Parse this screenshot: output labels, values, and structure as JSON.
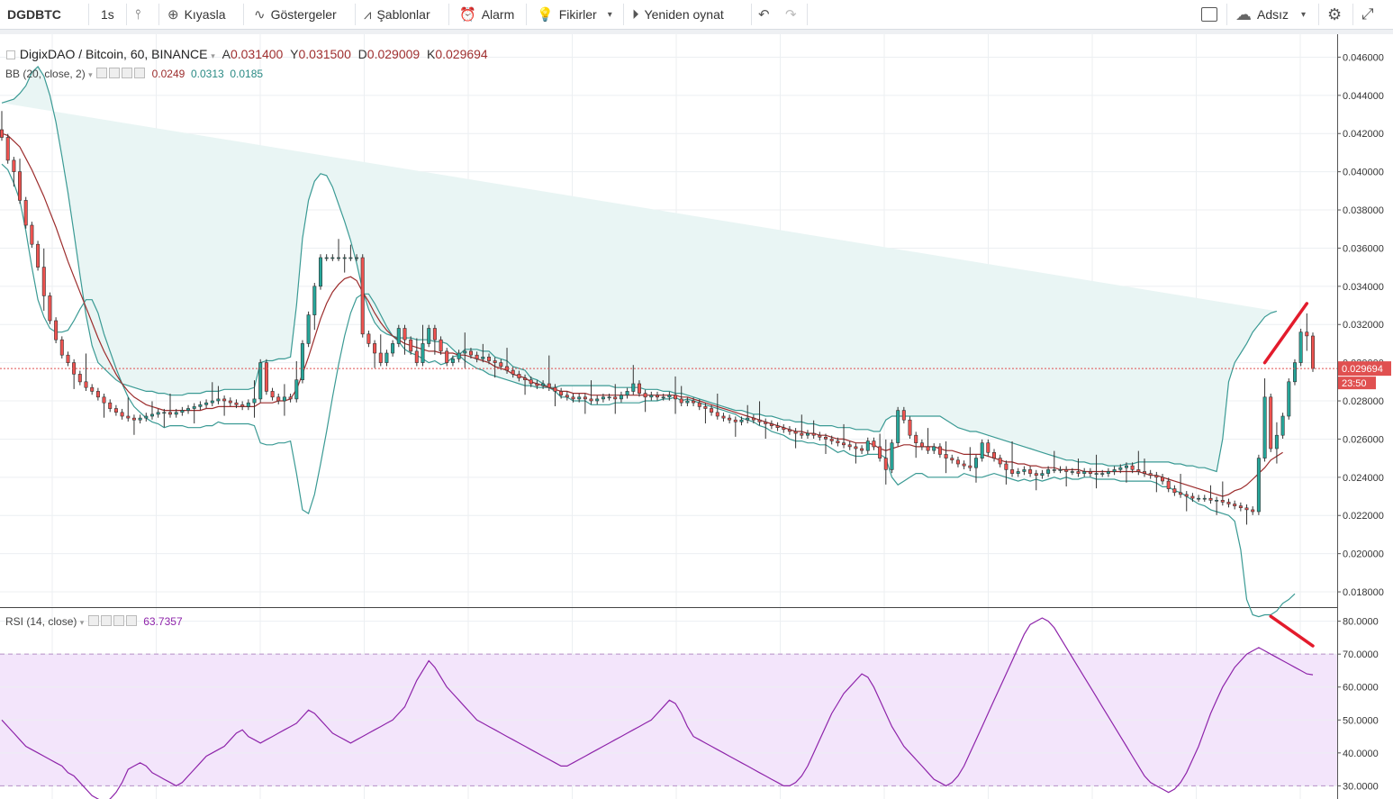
{
  "toolbar": {
    "symbol": "DGDBTC",
    "interval": "1s",
    "compare": "Kıyasla",
    "indicators": "Göstergeler",
    "templates": "Şablonlar",
    "alarm": "Alarm",
    "ideas": "Fikirler",
    "replay": "Yeniden oynat",
    "layout_name": "Adsız"
  },
  "legend": {
    "title": "DigixDAO / Bitcoin, 60, BINANCE",
    "o_label": "A",
    "o_value": "0.031400",
    "h_label": "Y",
    "h_value": "0.031500",
    "l_label": "D",
    "l_value": "0.029009",
    "c_label": "K",
    "c_value": "0.029694",
    "bb_label": "BB (20, close, 2)",
    "bb_mid": "0.0249",
    "bb_upper": "0.0313",
    "bb_lower": "0.0185",
    "rsi_label": "RSI (14, close)",
    "rsi_value": "63.7357"
  },
  "colors": {
    "up": "#26a69a",
    "down": "#ef5350",
    "candle_border": "#333333",
    "bb_band": "#3a9a94",
    "bb_fill": "#e9f5f4",
    "bb_basis": "#9c2c2c",
    "rsi_line": "#8e24aa",
    "rsi_band": "#f3e5fb",
    "annot": "#e31b2c",
    "last_price_bg": "#e05050"
  },
  "chart_data": [
    {
      "type": "candlestick",
      "title": "DigixDAO / Bitcoin, 60, BINANCE",
      "ylim": [
        0.0172,
        0.0472
      ],
      "yticks": [
        "0.046000",
        "0.044000",
        "0.042000",
        "0.040000",
        "0.038000",
        "0.036000",
        "0.034000",
        "0.032000",
        "0.030000",
        "0.028000",
        "0.026000",
        "0.024000",
        "0.022000",
        "0.020000",
        "0.018000"
      ],
      "last_price": "0.029694",
      "countdown": "23:50",
      "close": [
        0.0418,
        0.0406,
        0.04,
        0.0385,
        0.0372,
        0.0362,
        0.035,
        0.0335,
        0.0322,
        0.0312,
        0.0304,
        0.03,
        0.0294,
        0.029,
        0.0287,
        0.0285,
        0.0282,
        0.0279,
        0.0276,
        0.0274,
        0.0272,
        0.0271,
        0.027,
        0.0271,
        0.0272,
        0.0273,
        0.0274,
        0.0274,
        0.0273,
        0.0274,
        0.0275,
        0.0276,
        0.0277,
        0.0278,
        0.0279,
        0.028,
        0.0281,
        0.028,
        0.0279,
        0.0278,
        0.0277,
        0.0279,
        0.0281,
        0.03,
        0.0285,
        0.0282,
        0.028,
        0.0282,
        0.0281,
        0.0291,
        0.031,
        0.0325,
        0.034,
        0.0355,
        0.0355,
        0.0355,
        0.0355,
        0.0355,
        0.0355,
        0.0355,
        0.0315,
        0.031,
        0.0305,
        0.03,
        0.0305,
        0.031,
        0.0318,
        0.0312,
        0.0306,
        0.03,
        0.031,
        0.0318,
        0.0312,
        0.0306,
        0.03,
        0.0302,
        0.0305,
        0.0306,
        0.0304,
        0.0302,
        0.0303,
        0.0301,
        0.03,
        0.0298,
        0.0296,
        0.0294,
        0.0292,
        0.0291,
        0.0289,
        0.0288,
        0.0289,
        0.0287,
        0.0285,
        0.0283,
        0.0282,
        0.0281,
        0.0282,
        0.0281,
        0.028,
        0.0281,
        0.0282,
        0.0282,
        0.0281,
        0.0283,
        0.0285,
        0.0289,
        0.0284,
        0.0282,
        0.0283,
        0.0282,
        0.0282,
        0.0283,
        0.0281,
        0.0279,
        0.028,
        0.0279,
        0.0277,
        0.0276,
        0.0274,
        0.0272,
        0.0271,
        0.027,
        0.0269,
        0.027,
        0.0271,
        0.027,
        0.0269,
        0.0268,
        0.0267,
        0.0266,
        0.0265,
        0.0264,
        0.0263,
        0.0262,
        0.0263,
        0.0262,
        0.0261,
        0.026,
        0.0259,
        0.0258,
        0.0257,
        0.0256,
        0.0255,
        0.0254,
        0.0259,
        0.0256,
        0.025,
        0.0244,
        0.0258,
        0.0275,
        0.027,
        0.0262,
        0.0258,
        0.0256,
        0.0254,
        0.0256,
        0.0252,
        0.025,
        0.0249,
        0.0247,
        0.0246,
        0.0245,
        0.025,
        0.0258,
        0.0253,
        0.025,
        0.0247,
        0.0244,
        0.0242,
        0.0243,
        0.0244,
        0.0242,
        0.0241,
        0.0242,
        0.0244,
        0.0244,
        0.0244,
        0.0243,
        0.0243,
        0.0242,
        0.0243,
        0.0242,
        0.0242,
        0.0242,
        0.0243,
        0.0244,
        0.0245,
        0.0246,
        0.0244,
        0.0243,
        0.0242,
        0.0241,
        0.024,
        0.0238,
        0.0234,
        0.0232,
        0.0231,
        0.023,
        0.0229,
        0.0229,
        0.0229,
        0.0228,
        0.0228,
        0.0227,
        0.0226,
        0.0225,
        0.0224,
        0.0223,
        0.0222,
        0.025,
        0.0282,
        0.0255,
        0.0262,
        0.0272,
        0.029,
        0.03,
        0.0316,
        0.0314,
        0.0297
      ],
      "bb_basis": [
        0.042,
        0.0419,
        0.0416,
        0.0413,
        0.0407,
        0.0401,
        0.0394,
        0.0387,
        0.0379,
        0.0371,
        0.0362,
        0.0353,
        0.0345,
        0.0337,
        0.0329,
        0.0321,
        0.0313,
        0.0306,
        0.03,
        0.0294,
        0.0289,
        0.0285,
        0.0282,
        0.028,
        0.0278,
        0.0277,
        0.0276,
        0.0275,
        0.0275,
        0.0275,
        0.0275,
        0.0275,
        0.0275,
        0.0275,
        0.0276,
        0.0276,
        0.0277,
        0.0277,
        0.0277,
        0.0277,
        0.0277,
        0.0277,
        0.0277,
        0.0279,
        0.0279,
        0.0279,
        0.028,
        0.028,
        0.0281,
        0.0286,
        0.0294,
        0.0303,
        0.0313,
        0.0323,
        0.0331,
        0.0337,
        0.0341,
        0.0344,
        0.0345,
        0.0343,
        0.0337,
        0.0332,
        0.0326,
        0.0321,
        0.0317,
        0.0314,
        0.0312,
        0.031,
        0.0309,
        0.0308,
        0.0307,
        0.0306,
        0.0306,
        0.0305,
        0.0305,
        0.0305,
        0.0304,
        0.0304,
        0.0303,
        0.0302,
        0.0301,
        0.03,
        0.0298,
        0.0297,
        0.0296,
        0.0294,
        0.0293,
        0.0292,
        0.029,
        0.0289,
        0.0288,
        0.0287,
        0.0286,
        0.0285,
        0.0285,
        0.0284,
        0.0284,
        0.0284,
        0.0283,
        0.0283,
        0.0283,
        0.0283,
        0.0283,
        0.0283,
        0.0283,
        0.0283,
        0.0283,
        0.0283,
        0.0283,
        0.0283,
        0.0283,
        0.0283,
        0.0283,
        0.0282,
        0.0282,
        0.0281,
        0.028,
        0.0279,
        0.0278,
        0.0277,
        0.0276,
        0.0275,
        0.0274,
        0.0273,
        0.0272,
        0.0271,
        0.027,
        0.0269,
        0.0268,
        0.0267,
        0.0266,
        0.0265,
        0.0264,
        0.0264,
        0.0263,
        0.0263,
        0.0262,
        0.0262,
        0.0261,
        0.026,
        0.026,
        0.0259,
        0.0258,
        0.0258,
        0.0258,
        0.0257,
        0.0255,
        0.0254,
        0.0255,
        0.0256,
        0.0257,
        0.0257,
        0.0256,
        0.0256,
        0.0256,
        0.0256,
        0.0255,
        0.0254,
        0.0254,
        0.0253,
        0.0252,
        0.0252,
        0.0252,
        0.0252,
        0.0251,
        0.025,
        0.0249,
        0.0248,
        0.0248,
        0.0247,
        0.0247,
        0.0246,
        0.0246,
        0.0245,
        0.0245,
        0.0245,
        0.0244,
        0.0244,
        0.0244,
        0.0244,
        0.0243,
        0.0243,
        0.0243,
        0.0243,
        0.0243,
        0.0243,
        0.0243,
        0.0243,
        0.0243,
        0.0243,
        0.0242,
        0.0241,
        0.0241,
        0.024,
        0.0239,
        0.0238,
        0.0237,
        0.0236,
        0.0235,
        0.0234,
        0.0233,
        0.0232,
        0.0231,
        0.023,
        0.0231,
        0.0233,
        0.0234,
        0.0236,
        0.0239,
        0.0242,
        0.0245,
        0.0249,
        0.0251,
        0.0253
      ],
      "bb_upper": [
        0.0436,
        0.0437,
        0.0438,
        0.0441,
        0.0445,
        0.0452,
        0.0455,
        0.045,
        0.044,
        0.0426,
        0.0408,
        0.0389,
        0.0368,
        0.0346,
        0.0325,
        0.0309,
        0.03,
        0.0297,
        0.0294,
        0.0291,
        0.0289,
        0.0288,
        0.0287,
        0.0286,
        0.0285,
        0.0285,
        0.0284,
        0.0284,
        0.0283,
        0.0283,
        0.0283,
        0.0284,
        0.0284,
        0.0284,
        0.0285,
        0.0285,
        0.0285,
        0.0286,
        0.0286,
        0.0286,
        0.0286,
        0.0286,
        0.0287,
        0.03,
        0.0301,
        0.0301,
        0.0302,
        0.0302,
        0.0303,
        0.033,
        0.0365,
        0.0385,
        0.0395,
        0.0399,
        0.0398,
        0.0392,
        0.0383,
        0.0374,
        0.0364,
        0.0352,
        0.0338,
        0.0328,
        0.0321,
        0.0317,
        0.0315,
        0.0314,
        0.0313,
        0.0313,
        0.0313,
        0.0312,
        0.0312,
        0.0312,
        0.0311,
        0.0311,
        0.031,
        0.0307,
        0.0304,
        0.0301,
        0.0299,
        0.0297,
        0.0296,
        0.0294,
        0.0293,
        0.0292,
        0.0291,
        0.029,
        0.0289,
        0.0288,
        0.0288,
        0.0287,
        0.0287,
        0.0287,
        0.0287,
        0.0288,
        0.0288,
        0.0288,
        0.0288,
        0.0288,
        0.0288,
        0.0288,
        0.0288,
        0.0288,
        0.0287,
        0.0287,
        0.0287,
        0.0287,
        0.0287,
        0.0286,
        0.0286,
        0.0286,
        0.0285,
        0.0285,
        0.0284,
        0.0284,
        0.0283,
        0.0282,
        0.0281,
        0.028,
        0.0279,
        0.0278,
        0.0277,
        0.0276,
        0.0275,
        0.0275,
        0.0274,
        0.0273,
        0.0273,
        0.0272,
        0.0272,
        0.0271,
        0.027,
        0.027,
        0.0269,
        0.0269,
        0.0268,
        0.0268,
        0.0267,
        0.0267,
        0.0267,
        0.0266,
        0.0266,
        0.0266,
        0.0265,
        0.0265,
        0.0265,
        0.0264,
        0.0264,
        0.027,
        0.0272,
        0.0272,
        0.0272,
        0.0272,
        0.0272,
        0.0272,
        0.0272,
        0.0272,
        0.0272,
        0.027,
        0.0268,
        0.0266,
        0.0265,
        0.0264,
        0.0264,
        0.0263,
        0.0262,
        0.0261,
        0.026,
        0.0259,
        0.0258,
        0.0257,
        0.0256,
        0.0255,
        0.0254,
        0.0253,
        0.0252,
        0.0251,
        0.025,
        0.0249,
        0.0249,
        0.0248,
        0.0248,
        0.0247,
        0.0247,
        0.0247,
        0.0246,
        0.0246,
        0.0246,
        0.0247,
        0.0247,
        0.0248,
        0.0248,
        0.0248,
        0.0248,
        0.0248,
        0.0248,
        0.0247,
        0.0247,
        0.0246,
        0.0246,
        0.0245,
        0.0245,
        0.0244,
        0.0243,
        0.026,
        0.029,
        0.03,
        0.0305,
        0.031,
        0.0316,
        0.032,
        0.0324,
        0.0326,
        0.0327
      ],
      "bb_lower": [
        0.0404,
        0.0401,
        0.0394,
        0.0385,
        0.0369,
        0.035,
        0.0333,
        0.0324,
        0.0318,
        0.0316,
        0.0316,
        0.0317,
        0.0322,
        0.0328,
        0.0333,
        0.0333,
        0.0326,
        0.0315,
        0.0306,
        0.0297,
        0.0289,
        0.0282,
        0.0277,
        0.0274,
        0.0271,
        0.0269,
        0.0268,
        0.0266,
        0.0267,
        0.0267,
        0.0267,
        0.0266,
        0.0266,
        0.0266,
        0.0267,
        0.0267,
        0.0269,
        0.0268,
        0.0268,
        0.0268,
        0.0268,
        0.0268,
        0.0267,
        0.0258,
        0.0257,
        0.0257,
        0.0258,
        0.0258,
        0.0259,
        0.0242,
        0.0223,
        0.0221,
        0.0231,
        0.0247,
        0.0264,
        0.0282,
        0.0299,
        0.0314,
        0.0326,
        0.0334,
        0.0336,
        0.0336,
        0.0331,
        0.0325,
        0.0319,
        0.0314,
        0.0311,
        0.0307,
        0.0305,
        0.0304,
        0.0302,
        0.03,
        0.0301,
        0.0299,
        0.03,
        0.0303,
        0.0304,
        0.0307,
        0.0307,
        0.0307,
        0.0306,
        0.0306,
        0.0303,
        0.0302,
        0.0301,
        0.0298,
        0.0297,
        0.0296,
        0.0292,
        0.0291,
        0.0289,
        0.0287,
        0.0285,
        0.0282,
        0.0282,
        0.028,
        0.028,
        0.028,
        0.0278,
        0.0278,
        0.0278,
        0.0278,
        0.0279,
        0.0279,
        0.0279,
        0.0279,
        0.0279,
        0.028,
        0.028,
        0.028,
        0.0281,
        0.0281,
        0.0282,
        0.028,
        0.0281,
        0.028,
        0.0279,
        0.0278,
        0.0277,
        0.0276,
        0.0275,
        0.0274,
        0.0273,
        0.0271,
        0.027,
        0.0269,
        0.0267,
        0.0266,
        0.0264,
        0.0263,
        0.0262,
        0.026,
        0.0259,
        0.0259,
        0.0258,
        0.0258,
        0.0257,
        0.0257,
        0.0255,
        0.0253,
        0.0254,
        0.0252,
        0.0251,
        0.0251,
        0.0252,
        0.0252,
        0.0252,
        0.025,
        0.024,
        0.0236,
        0.0238,
        0.024,
        0.0242,
        0.0242,
        0.024,
        0.024,
        0.024,
        0.024,
        0.024,
        0.024,
        0.0242,
        0.0241,
        0.024,
        0.024,
        0.0241,
        0.0242,
        0.0241,
        0.024,
        0.0239,
        0.0238,
        0.0239,
        0.0238,
        0.0239,
        0.0238,
        0.0239,
        0.024,
        0.0239,
        0.024,
        0.0239,
        0.0239,
        0.024,
        0.024,
        0.0239,
        0.0239,
        0.0239,
        0.0239,
        0.0238,
        0.0238,
        0.0238,
        0.0238,
        0.0238,
        0.0238,
        0.0237,
        0.0235,
        0.0235,
        0.0233,
        0.0232,
        0.023,
        0.0228,
        0.0226,
        0.0225,
        0.0223,
        0.0222,
        0.0221,
        0.022,
        0.0217,
        0.0202,
        0.0176,
        0.0168,
        0.0167,
        0.0168,
        0.0168,
        0.017,
        0.0174,
        0.0176,
        0.0179
      ]
    },
    {
      "type": "line",
      "title": "RSI (14, close)",
      "ylim": [
        26,
        84
      ],
      "yticks": [
        "80.0000",
        "70.0000",
        "60.0000",
        "50.0000",
        "40.0000",
        "30.0000"
      ],
      "band": [
        30,
        70
      ],
      "last_value": "63.7357",
      "values": [
        50,
        48,
        46,
        44,
        42,
        41,
        40,
        39,
        38,
        37,
        36,
        34,
        33,
        31,
        29,
        27,
        26,
        25,
        26,
        28,
        31,
        35,
        36,
        37,
        36,
        34,
        33,
        32,
        31,
        30,
        31,
        33,
        35,
        37,
        39,
        40,
        41,
        42,
        44,
        46,
        47,
        45,
        44,
        43,
        44,
        45,
        46,
        47,
        48,
        49,
        51,
        53,
        52,
        50,
        48,
        46,
        45,
        44,
        43,
        44,
        45,
        46,
        47,
        48,
        49,
        50,
        52,
        54,
        58,
        62,
        65,
        68,
        66,
        63,
        60,
        58,
        56,
        54,
        52,
        50,
        49,
        48,
        47,
        46,
        45,
        44,
        43,
        42,
        41,
        40,
        39,
        38,
        37,
        36,
        36,
        37,
        38,
        39,
        40,
        41,
        42,
        43,
        44,
        45,
        46,
        47,
        48,
        49,
        50,
        52,
        54,
        56,
        55,
        52,
        48,
        45,
        44,
        43,
        42,
        41,
        40,
        39,
        38,
        37,
        36,
        35,
        34,
        33,
        32,
        31,
        30,
        30,
        31,
        33,
        36,
        40,
        44,
        48,
        52,
        55,
        58,
        60,
        62,
        64,
        63,
        60,
        56,
        52,
        48,
        45,
        42,
        40,
        38,
        36,
        34,
        32,
        31,
        30,
        31,
        33,
        36,
        40,
        44,
        48,
        52,
        56,
        60,
        64,
        68,
        72,
        76,
        79,
        80,
        81,
        80,
        78,
        75,
        72,
        69,
        66,
        63,
        60,
        57,
        54,
        51,
        48,
        45,
        42,
        39,
        36,
        33,
        31,
        30,
        29,
        28,
        29,
        31,
        34,
        38,
        42,
        47,
        52,
        56,
        60,
        63,
        66,
        68,
        70,
        71,
        72,
        71,
        70,
        69,
        68,
        67,
        66,
        65,
        64,
        63.7357
      ]
    }
  ]
}
